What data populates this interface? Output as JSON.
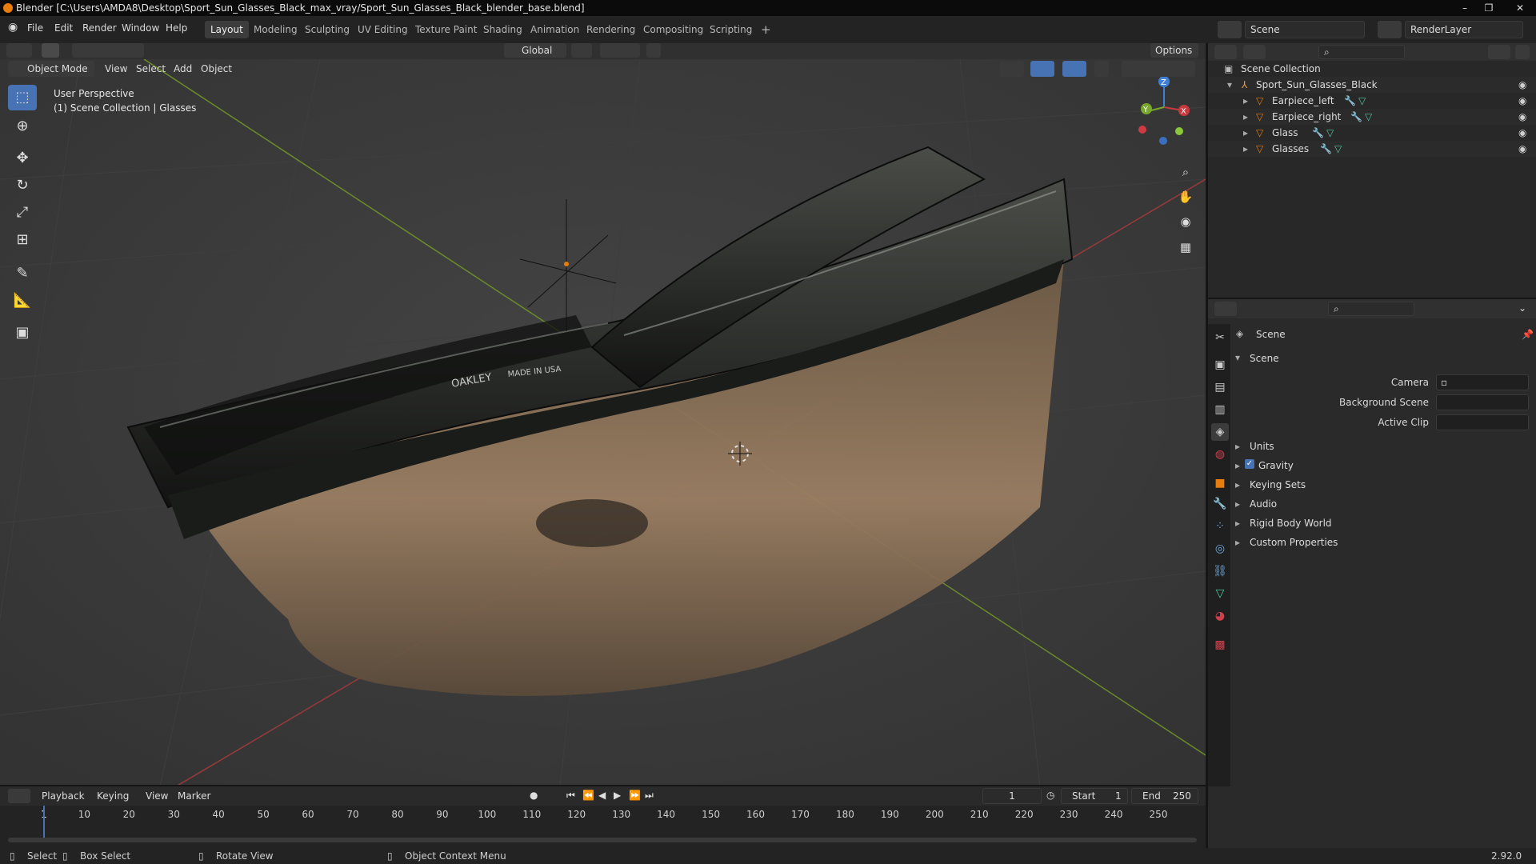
{
  "title": "Blender [C:\\Users\\AMDA8\\Desktop\\Sport_Sun_Glasses_Black_max_vray/Sport_Sun_Glasses_Black_blender_base.blend]",
  "menu": [
    "File",
    "Edit",
    "Render",
    "Window",
    "Help"
  ],
  "workspaces": [
    "Layout",
    "Modeling",
    "Sculpting",
    "UV Editing",
    "Texture Paint",
    "Shading",
    "Animation",
    "Rendering",
    "Compositing",
    "Scripting"
  ],
  "active_workspace": "Layout",
  "scene_name": "Scene",
  "render_layer": "RenderLayer",
  "viewport": {
    "mode": "Object Mode",
    "menus": [
      "View",
      "Select",
      "Add",
      "Object"
    ],
    "orientation": "Global",
    "options": "Options",
    "overlay_line1": "User Perspective",
    "overlay_line2": "(1) Scene Collection | Glasses",
    "brand_text": "OAKLEY",
    "made_in": "MADE IN USA"
  },
  "outliner": {
    "root": "Scene Collection",
    "collection": "Sport_Sun_Glasses_Black",
    "objects": [
      "Earpiece_left",
      "Earpiece_right",
      "Glass",
      "Glasses"
    ]
  },
  "properties": {
    "header": "Scene",
    "panel": "Scene",
    "camera_label": "Camera",
    "bg_scene_label": "Background Scene",
    "active_clip_label": "Active Clip",
    "sections": [
      "Units",
      "Gravity",
      "Keying Sets",
      "Audio",
      "Rigid Body World",
      "Custom Properties"
    ]
  },
  "timeline": {
    "menus": [
      "Playback",
      "Keying",
      "View",
      "Marker"
    ],
    "current_frame": "1",
    "start_label": "Start",
    "start": "1",
    "end_label": "End",
    "end": "250",
    "ticks": [
      "1",
      "10",
      "20",
      "30",
      "40",
      "50",
      "60",
      "70",
      "80",
      "90",
      "100",
      "110",
      "120",
      "130",
      "140",
      "150",
      "160",
      "170",
      "180",
      "190",
      "200",
      "210",
      "220",
      "230",
      "240",
      "250"
    ]
  },
  "status": {
    "select": "Select",
    "box_select": "Box Select",
    "rotate_view": "Rotate View",
    "context_menu": "Object Context Menu",
    "version": "2.92.0"
  },
  "colors": {
    "accent": "#4772b3",
    "x_axis": "#c8393f",
    "y_axis": "#7aa72e",
    "z_axis": "#3e7fd8",
    "orange": "#e87d0d"
  }
}
